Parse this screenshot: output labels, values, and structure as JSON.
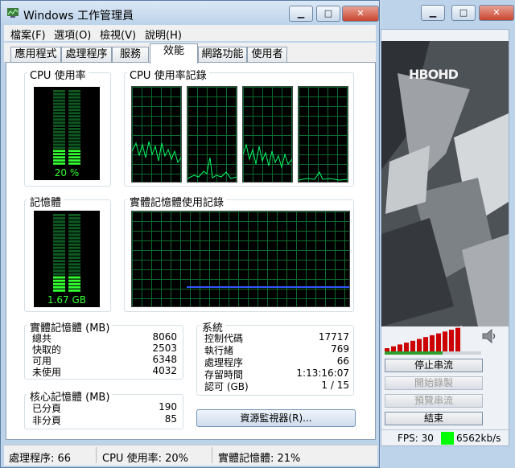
{
  "task_manager": {
    "title": "Windows 工作管理員",
    "window_controls": {
      "minimize": "▁",
      "maximize": "□",
      "close": "✕"
    },
    "menu": [
      "檔案(F)",
      "選項(O)",
      "檢視(V)",
      "說明(H)"
    ],
    "tabs": [
      "應用程式",
      "處理程序",
      "服務",
      "效能",
      "網路功能",
      "使用者"
    ],
    "active_tab": "效能",
    "performance": {
      "cpu_usage_label": "CPU 使用率",
      "cpu_usage_value": "20 %",
      "cpu_usage_fraction": 0.2,
      "cpu_history_label": "CPU 使用率記錄",
      "memory_label": "記憶體",
      "memory_value": "1.67 GB",
      "memory_fraction": 0.21,
      "memory_history_label": "實體記憶體使用記錄",
      "physical_memory": {
        "label": "實體記憶體 (MB)",
        "rows": [
          {
            "name": "總共",
            "value": "8060"
          },
          {
            "name": "快取的",
            "value": "2503"
          },
          {
            "name": "可用",
            "value": "6348"
          },
          {
            "name": "未使用",
            "value": "4032"
          }
        ]
      },
      "system": {
        "label": "系統",
        "rows": [
          {
            "name": "控制代碼",
            "value": "17717"
          },
          {
            "name": "執行緒",
            "value": "769"
          },
          {
            "name": "處理程序",
            "value": "66"
          },
          {
            "name": "存留時間",
            "value": "1:13:16:07"
          },
          {
            "name": "認可 (GB)",
            "value": "1 / 15"
          }
        ]
      },
      "kernel_memory": {
        "label": "核心記憶體 (MB)",
        "rows": [
          {
            "name": "已分頁",
            "value": "190"
          },
          {
            "name": "非分頁",
            "value": "85"
          }
        ]
      },
      "resource_monitor_button": "資源監視器(R)..."
    },
    "status_bar": {
      "processes": "處理程序: 66",
      "cpu": "CPU 使用率: 20%",
      "memory": "實體記憶體: 21%"
    }
  },
  "player": {
    "window_controls": {
      "minimize": "▁",
      "maximize": "□",
      "close": "✕"
    },
    "channel_logo": "HBOHD",
    "volume_icon": "speaker-icon",
    "buttons": [
      {
        "label": "停止串流",
        "enabled": true
      },
      {
        "label": "開始錄製",
        "enabled": false
      },
      {
        "label": "預覽串流",
        "enabled": false
      },
      {
        "label": "結束",
        "enabled": true
      }
    ],
    "fps": "FPS: 30",
    "bitrate": "6562kb/s"
  },
  "colors": {
    "meter_green": "#33ff33",
    "graph_green": "#00ff66",
    "memory_line": "#3355ff",
    "status_ok": "#00ff00",
    "volume_red": "#cc0000"
  }
}
